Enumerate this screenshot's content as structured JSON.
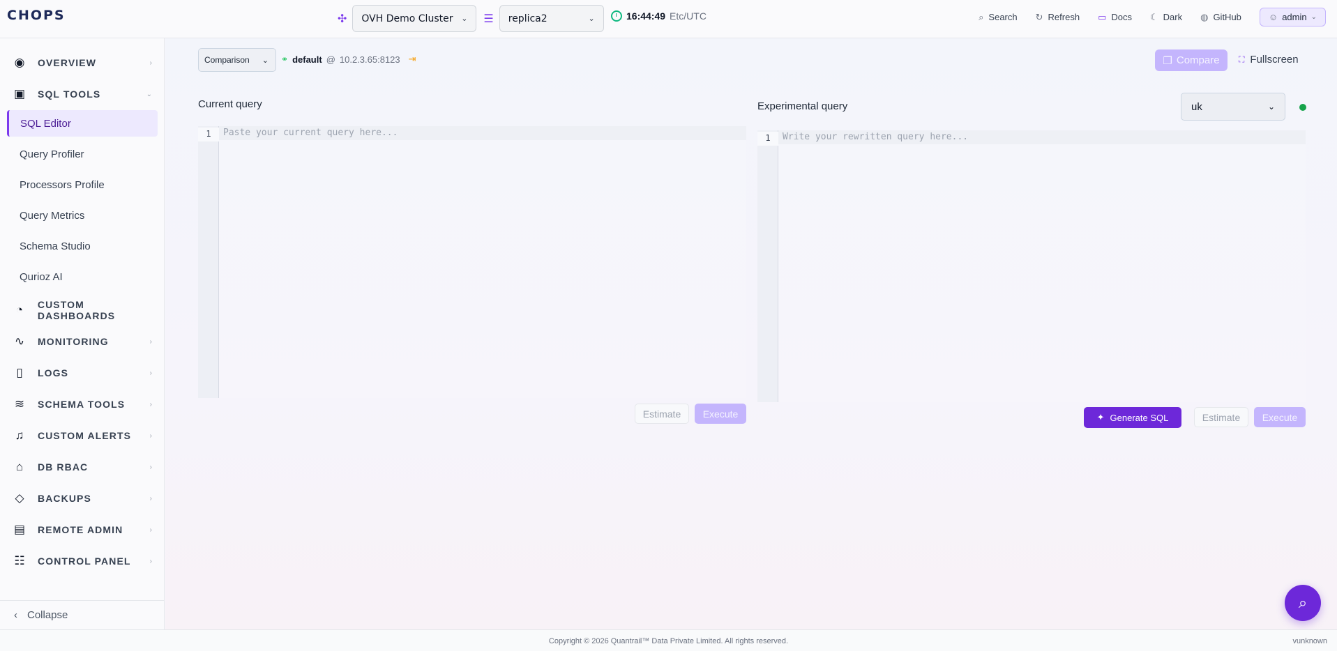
{
  "topbar": {
    "logo": "CHOPS",
    "cluster": "OVH Demo Cluster",
    "replica": "replica2",
    "time": "16:44:49",
    "timezone": "Etc/UTC",
    "nav": {
      "search": "Search",
      "refresh": "Refresh",
      "docs": "Docs",
      "dark": "Dark",
      "github": "GitHub",
      "user": "admin"
    }
  },
  "sidebar": {
    "sections": [
      {
        "label": "OVERVIEW",
        "icon": "eye-icon"
      },
      {
        "label": "SQL TOOLS",
        "icon": "terminal-icon"
      },
      {
        "label": "CUSTOM DASHBOARDS",
        "icon": "pie-chart-icon"
      },
      {
        "label": "MONITORING",
        "icon": "activity-icon"
      },
      {
        "label": "LOGS",
        "icon": "file-icon"
      },
      {
        "label": "SCHEMA TOOLS",
        "icon": "database-icon"
      },
      {
        "label": "CUSTOM ALERTS",
        "icon": "bell-icon"
      },
      {
        "label": "DB RBAC",
        "icon": "lock-icon"
      },
      {
        "label": "BACKUPS",
        "icon": "shield-icon"
      },
      {
        "label": "REMOTE ADMIN",
        "icon": "server-icon"
      },
      {
        "label": "CONTROL PANEL",
        "icon": "sliders-icon"
      }
    ],
    "sql_items": [
      {
        "label": "SQL Editor",
        "active": true
      },
      {
        "label": "Query Profiler"
      },
      {
        "label": "Processors Profile"
      },
      {
        "label": "Query Metrics"
      },
      {
        "label": "Schema Studio"
      },
      {
        "label": "Qurioz AI"
      }
    ],
    "collapse": "Collapse"
  },
  "toolbar": {
    "mode": "Comparison",
    "database": "default",
    "at": "@",
    "host": "10.2.3.65:8123",
    "compare": "Compare",
    "fullscreen": "Fullscreen"
  },
  "current": {
    "title": "Current query",
    "line_number": "1",
    "placeholder": "Paste your current query here...",
    "estimate": "Estimate",
    "execute": "Execute"
  },
  "experimental": {
    "title": "Experimental query",
    "replica_select": "uk",
    "line_number": "1",
    "placeholder": "Write your rewritten query here...",
    "generate": "Generate SQL",
    "estimate": "Estimate",
    "execute": "Execute"
  },
  "footer": {
    "copyright": "Copyright © 2026 Quantrail™ Data Private Limited. All rights reserved.",
    "version": "vunknown"
  },
  "colors": {
    "accent": "#6d28d9",
    "accent_light": "#c4b5fd",
    "status_ok": "#16a34a"
  }
}
